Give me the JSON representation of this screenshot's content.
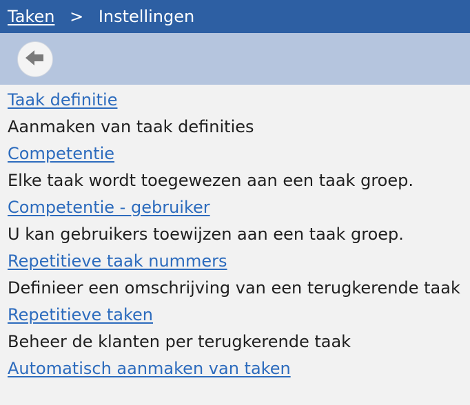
{
  "breadcrumb": {
    "root_label": "Taken",
    "separator": ">",
    "current_label": "Instellingen"
  },
  "toolbar": {
    "back_icon": "arrow-left-icon"
  },
  "items": [
    {
      "label": "Taak definitie",
      "description": "Aanmaken van taak definities"
    },
    {
      "label": "Competentie",
      "description": "Elke taak wordt toegewezen aan een taak groep."
    },
    {
      "label": "Competentie - gebruiker",
      "description": "U kan gebruikers toewijzen aan een taak groep."
    },
    {
      "label": "Repetitieve taak nummers",
      "description": "Definieer een omschrijving van een terugkerende taak"
    },
    {
      "label": "Repetitieve taken",
      "description": "Beheer de klanten per terugkerende taak"
    },
    {
      "label": "Automatisch aanmaken van taken"
    }
  ],
  "colors": {
    "header_bg": "#2d5fa3",
    "toolbar_bg": "#b5c5de",
    "link": "#2c6bbd",
    "page_bg": "#f2f2f2"
  }
}
